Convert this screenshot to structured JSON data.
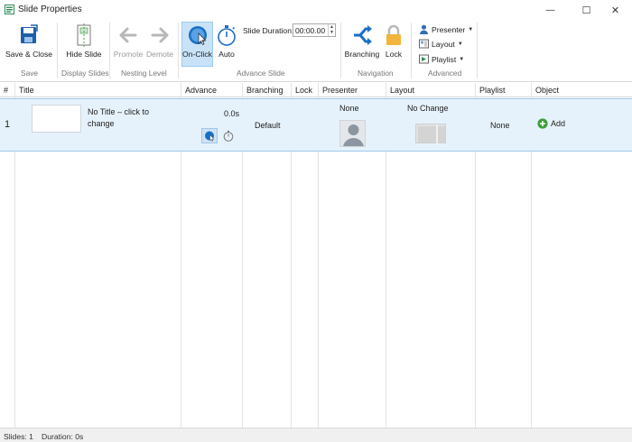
{
  "window": {
    "title": "Slide Properties",
    "controls": {
      "minimize": "—",
      "maximize": "☐",
      "close": "✕"
    }
  },
  "ribbon": {
    "groups": {
      "save": "Save",
      "display_slides": "Display Slides",
      "nesting_level": "Nesting Level",
      "advance_slide": "Advance Slide",
      "navigation": "Navigation",
      "advanced": "Advanced"
    },
    "buttons": {
      "save_close": "Save & Close",
      "hide_slide": "Hide Slide",
      "promote": "Promote",
      "demote": "Demote",
      "on_click": "On-Click",
      "auto": "Auto",
      "branching": "Branching",
      "lock": "Lock"
    },
    "slide_duration": {
      "label": "Slide Duration:",
      "value": "00:00.00"
    },
    "advanced_items": {
      "presenter": "Presenter",
      "layout": "Layout",
      "playlist": "Playlist"
    },
    "colors": {
      "accent": "#1a6fc4",
      "selected_bg": "#c9e2f7"
    }
  },
  "grid": {
    "headers": [
      "#",
      "Title",
      "Advance",
      "Branching",
      "Lock",
      "Presenter",
      "Layout",
      "Playlist",
      "Object"
    ],
    "rows": [
      {
        "num": "1",
        "title": "No Title – click to change",
        "advance": "0.0s",
        "branching": "Default",
        "presenter": "None",
        "layout": "No Change",
        "playlist": "None",
        "object": "Add"
      }
    ],
    "colors": {
      "row_selected": "#e6f2fb"
    }
  },
  "statusbar": {
    "slides": "Slides: 1",
    "duration": "Duration:  0s"
  }
}
